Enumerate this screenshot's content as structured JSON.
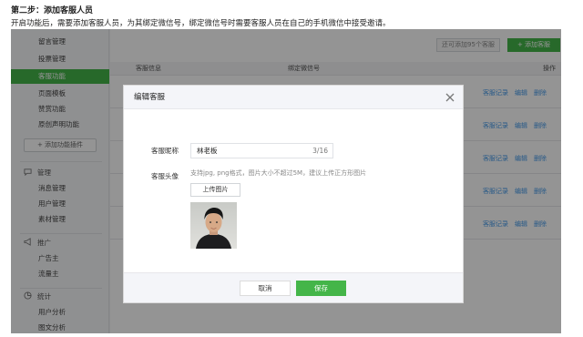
{
  "instructions": {
    "step_title": "第二步：添加客服人员",
    "step_desc": "开启功能后，需要添加客服人员，为其绑定微信号，绑定微信号时需要客服人员在自己的手机微信中接受邀请。"
  },
  "sidebar": {
    "items": [
      {
        "label": "留言管理",
        "active": false
      },
      {
        "label": "投票管理",
        "active": false
      },
      {
        "label": "客服功能",
        "active": true
      },
      {
        "label": "页面模板",
        "active": false
      },
      {
        "label": "赞赏功能",
        "active": false
      },
      {
        "label": "原创声明功能",
        "active": false
      }
    ],
    "add_plugin_label": "+ 添加功能插件",
    "sections": [
      {
        "title": "管理",
        "icon": "chat-bubble-icon",
        "items": [
          "消息管理",
          "用户管理",
          "素材管理"
        ]
      },
      {
        "title": "推广",
        "icon": "megaphone-icon",
        "items": [
          "广告主",
          "流量主"
        ]
      },
      {
        "title": "统计",
        "icon": "chart-icon",
        "items": [
          "用户分析",
          "图文分析"
        ]
      }
    ]
  },
  "main": {
    "count_label": "还可添加95个客服",
    "add_button_label": "+ 添加客服",
    "table_headers": {
      "info": "客服信息",
      "wechat": "绑定微信号",
      "actions": "操作"
    },
    "row_actions": [
      "客服记录",
      "编辑",
      "删除"
    ],
    "row_count": 5
  },
  "modal": {
    "title": "编辑客服",
    "nickname_label": "客服昵称",
    "nickname_value": "林老板",
    "nickname_count": "3/16",
    "avatar_label": "客服头像",
    "avatar_tip": "支持jpg, png格式，图片大小不超过5M，建议上传正方形图片",
    "upload_label": "上传图片",
    "cancel_label": "取消",
    "save_label": "保存"
  },
  "colors": {
    "accent_green": "#44b549",
    "link_blue": "#459ae9"
  }
}
